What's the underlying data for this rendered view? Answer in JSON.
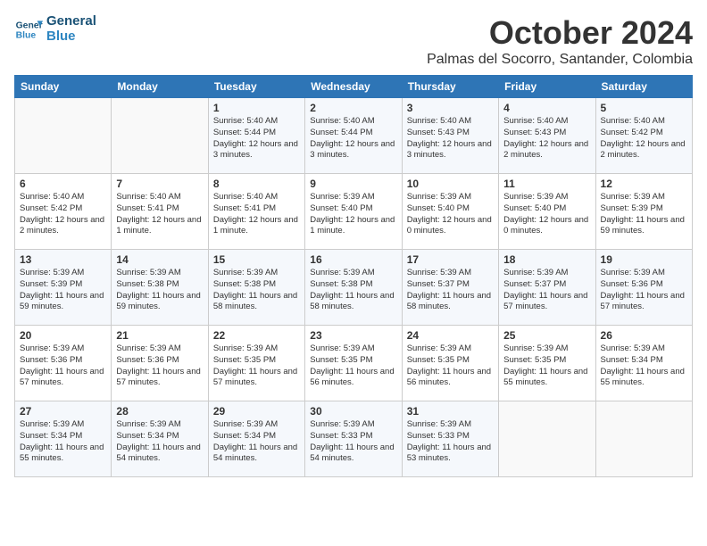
{
  "header": {
    "logo_line1": "General",
    "logo_line2": "Blue",
    "title": "October 2024",
    "subtitle": "Palmas del Socorro, Santander, Colombia"
  },
  "weekdays": [
    "Sunday",
    "Monday",
    "Tuesday",
    "Wednesday",
    "Thursday",
    "Friday",
    "Saturday"
  ],
  "weeks": [
    [
      {
        "day": "",
        "info": ""
      },
      {
        "day": "",
        "info": ""
      },
      {
        "day": "1",
        "info": "Sunrise: 5:40 AM\nSunset: 5:44 PM\nDaylight: 12 hours and 3 minutes."
      },
      {
        "day": "2",
        "info": "Sunrise: 5:40 AM\nSunset: 5:44 PM\nDaylight: 12 hours and 3 minutes."
      },
      {
        "day": "3",
        "info": "Sunrise: 5:40 AM\nSunset: 5:43 PM\nDaylight: 12 hours and 3 minutes."
      },
      {
        "day": "4",
        "info": "Sunrise: 5:40 AM\nSunset: 5:43 PM\nDaylight: 12 hours and 2 minutes."
      },
      {
        "day": "5",
        "info": "Sunrise: 5:40 AM\nSunset: 5:42 PM\nDaylight: 12 hours and 2 minutes."
      }
    ],
    [
      {
        "day": "6",
        "info": "Sunrise: 5:40 AM\nSunset: 5:42 PM\nDaylight: 12 hours and 2 minutes."
      },
      {
        "day": "7",
        "info": "Sunrise: 5:40 AM\nSunset: 5:41 PM\nDaylight: 12 hours and 1 minute."
      },
      {
        "day": "8",
        "info": "Sunrise: 5:40 AM\nSunset: 5:41 PM\nDaylight: 12 hours and 1 minute."
      },
      {
        "day": "9",
        "info": "Sunrise: 5:39 AM\nSunset: 5:40 PM\nDaylight: 12 hours and 1 minute."
      },
      {
        "day": "10",
        "info": "Sunrise: 5:39 AM\nSunset: 5:40 PM\nDaylight: 12 hours and 0 minutes."
      },
      {
        "day": "11",
        "info": "Sunrise: 5:39 AM\nSunset: 5:40 PM\nDaylight: 12 hours and 0 minutes."
      },
      {
        "day": "12",
        "info": "Sunrise: 5:39 AM\nSunset: 5:39 PM\nDaylight: 11 hours and 59 minutes."
      }
    ],
    [
      {
        "day": "13",
        "info": "Sunrise: 5:39 AM\nSunset: 5:39 PM\nDaylight: 11 hours and 59 minutes."
      },
      {
        "day": "14",
        "info": "Sunrise: 5:39 AM\nSunset: 5:38 PM\nDaylight: 11 hours and 59 minutes."
      },
      {
        "day": "15",
        "info": "Sunrise: 5:39 AM\nSunset: 5:38 PM\nDaylight: 11 hours and 58 minutes."
      },
      {
        "day": "16",
        "info": "Sunrise: 5:39 AM\nSunset: 5:38 PM\nDaylight: 11 hours and 58 minutes."
      },
      {
        "day": "17",
        "info": "Sunrise: 5:39 AM\nSunset: 5:37 PM\nDaylight: 11 hours and 58 minutes."
      },
      {
        "day": "18",
        "info": "Sunrise: 5:39 AM\nSunset: 5:37 PM\nDaylight: 11 hours and 57 minutes."
      },
      {
        "day": "19",
        "info": "Sunrise: 5:39 AM\nSunset: 5:36 PM\nDaylight: 11 hours and 57 minutes."
      }
    ],
    [
      {
        "day": "20",
        "info": "Sunrise: 5:39 AM\nSunset: 5:36 PM\nDaylight: 11 hours and 57 minutes."
      },
      {
        "day": "21",
        "info": "Sunrise: 5:39 AM\nSunset: 5:36 PM\nDaylight: 11 hours and 57 minutes."
      },
      {
        "day": "22",
        "info": "Sunrise: 5:39 AM\nSunset: 5:35 PM\nDaylight: 11 hours and 57 minutes."
      },
      {
        "day": "23",
        "info": "Sunrise: 5:39 AM\nSunset: 5:35 PM\nDaylight: 11 hours and 56 minutes."
      },
      {
        "day": "24",
        "info": "Sunrise: 5:39 AM\nSunset: 5:35 PM\nDaylight: 11 hours and 56 minutes."
      },
      {
        "day": "25",
        "info": "Sunrise: 5:39 AM\nSunset: 5:35 PM\nDaylight: 11 hours and 55 minutes."
      },
      {
        "day": "26",
        "info": "Sunrise: 5:39 AM\nSunset: 5:34 PM\nDaylight: 11 hours and 55 minutes."
      }
    ],
    [
      {
        "day": "27",
        "info": "Sunrise: 5:39 AM\nSunset: 5:34 PM\nDaylight: 11 hours and 55 minutes."
      },
      {
        "day": "28",
        "info": "Sunrise: 5:39 AM\nSunset: 5:34 PM\nDaylight: 11 hours and 54 minutes."
      },
      {
        "day": "29",
        "info": "Sunrise: 5:39 AM\nSunset: 5:34 PM\nDaylight: 11 hours and 54 minutes."
      },
      {
        "day": "30",
        "info": "Sunrise: 5:39 AM\nSunset: 5:33 PM\nDaylight: 11 hours and 54 minutes."
      },
      {
        "day": "31",
        "info": "Sunrise: 5:39 AM\nSunset: 5:33 PM\nDaylight: 11 hours and 53 minutes."
      },
      {
        "day": "",
        "info": ""
      },
      {
        "day": "",
        "info": ""
      }
    ]
  ]
}
